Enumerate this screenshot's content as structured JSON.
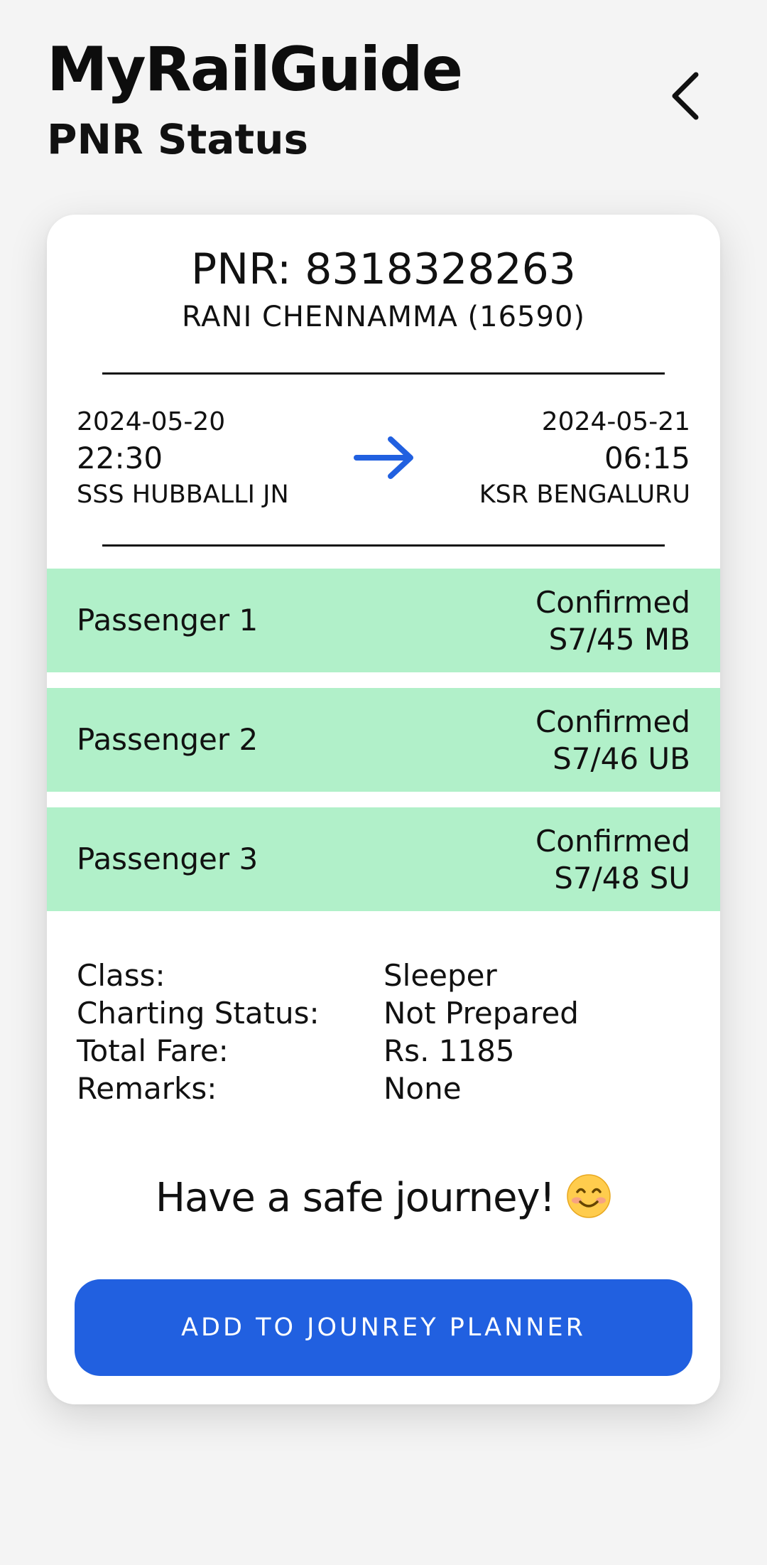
{
  "header": {
    "app_title": "MyRailGuide",
    "screen_title": "PNR Status",
    "back_icon": "chevron-left-icon"
  },
  "ticket": {
    "pnr_label": "PNR: 8318328263",
    "train_name": "RANI CHENNAMMA (16590)",
    "departure": {
      "date": "2024-05-20",
      "time": "22:30",
      "station": "SSS HUBBALLI JN"
    },
    "arrival": {
      "date": "2024-05-21",
      "time": "06:15",
      "station": "KSR BENGALURU"
    },
    "route_icon": "arrow-right-icon"
  },
  "passengers": [
    {
      "name": "Passenger 1",
      "status": "Confirmed",
      "berth": "S7/45 MB"
    },
    {
      "name": "Passenger 2",
      "status": "Confirmed",
      "berth": "S7/46 UB"
    },
    {
      "name": "Passenger 3",
      "status": "Confirmed",
      "berth": "S7/48 SU"
    }
  ],
  "details": [
    {
      "label": "Class:",
      "value": "Sleeper"
    },
    {
      "label": "Charting Status:",
      "value": "Not Prepared"
    },
    {
      "label": "Total Fare:",
      "value": "Rs. 1185"
    },
    {
      "label": "Remarks:",
      "value": "None"
    }
  ],
  "greeting": {
    "text": "Have a safe journey!",
    "emoji_icon": "smiling-face-icon"
  },
  "actions": {
    "add_planner_label": "ADD TO JOUNREY PLANNER"
  },
  "colors": {
    "background": "#f4f4f4",
    "card": "#ffffff",
    "passenger_confirmed": "#b1f0c9",
    "accent_blue": "#2160e0",
    "text": "#111111"
  }
}
